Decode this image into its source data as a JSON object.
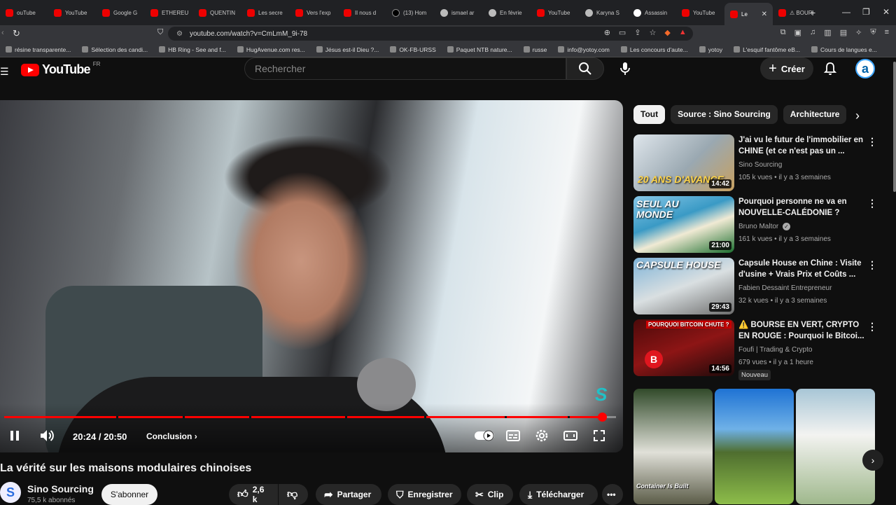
{
  "browser": {
    "tabs": [
      {
        "label": "ouTube",
        "fav": "yt"
      },
      {
        "label": "YouTube",
        "fav": "yt"
      },
      {
        "label": "Google G",
        "fav": "yt"
      },
      {
        "label": "ETHEREU",
        "fav": "yt"
      },
      {
        "label": "QUENTIN",
        "fav": "yt"
      },
      {
        "label": "Les secre",
        "fav": "yt"
      },
      {
        "label": "Vers l'exp",
        "fav": "yt"
      },
      {
        "label": "Il nous d",
        "fav": "yt"
      },
      {
        "label": "(13) Hom",
        "fav": "x"
      },
      {
        "label": "ismael ar",
        "fav": "g"
      },
      {
        "label": "En févrie",
        "fav": "g"
      },
      {
        "label": "YouTube",
        "fav": "yt"
      },
      {
        "label": "Karyna S",
        "fav": "g"
      },
      {
        "label": "Assassin",
        "fav": "w"
      },
      {
        "label": "YouTube",
        "fav": "yt"
      },
      {
        "label": "Le",
        "fav": "yt",
        "active": true
      },
      {
        "label": "⚠ BOUR",
        "fav": "yt"
      }
    ],
    "url": "youtube.com/watch?v=CmLmM_9i-78",
    "bookmarks": [
      "résine transparente...",
      "Sélection des candi...",
      "HB Ring - See and f...",
      "HugAvenue.com res...",
      "Jésus est-il Dieu ?...",
      "OK-FB-URSS",
      "Paquet NTB nature...",
      "russe",
      "info@yotoy.com",
      "Les concours d'aute...",
      "yotoy",
      "L'esquif fantôme eB...",
      "Cours de langues e..."
    ]
  },
  "header": {
    "logo_text": "YouTube",
    "country": "FR",
    "search_placeholder": "Rechercher",
    "create_label": "Créer",
    "avatar_letter": "a"
  },
  "player": {
    "time": "20:24 / 20:50",
    "chapter": "Conclusion",
    "progress": 0.977,
    "watermark": "S"
  },
  "video": {
    "title": "La vérité sur les maisons modulaires chinoises",
    "channel": "Sino Sourcing",
    "subscribers": "75,5 k abonnés",
    "subscribe_label": "S'abonner",
    "likes": "2,6 k",
    "share_label": "Partager",
    "save_label": "Enregistrer",
    "clip_label": "Clip",
    "download_label": "Télécharger"
  },
  "chips": [
    "Tout",
    "Source : Sino Sourcing",
    "Architecture"
  ],
  "recommendations": [
    {
      "title": "J'ai vu le futur de l'immobilier en CHINE (et ce n'est pas un ...",
      "channel": "Sino Sourcing",
      "meta": "105 k vues • il y a 3 semaines",
      "duration": "14:42",
      "thumb_text": "20 ANS D'AVANCE"
    },
    {
      "title": "Pourquoi personne ne va en NOUVELLE-CALÉDONIE ?",
      "channel": "Bruno Maltor",
      "verified": true,
      "meta": "161 k vues • il y a 3 semaines",
      "duration": "21:00",
      "thumb_text": "SEUL AU MONDE"
    },
    {
      "title": "Capsule House en Chine : Visite d'usine + Vrais Prix et Coûts ...",
      "channel": "Fabien Dessaint Entrepreneur",
      "meta": "32 k vues • il y a 3 semaines",
      "duration": "29:43",
      "thumb_text": "CAPSULE HOUSE"
    },
    {
      "title": "⚠️ BOURSE EN VERT, CRYPTO EN ROUGE : Pourquoi le Bitcoi...",
      "channel": "Foufi | Trading & Crypto",
      "meta": "679 vues • il y a 1 heure",
      "duration": "14:56",
      "badge": "Nouveau",
      "thumb_text": "POURQUOI BITCOIN CHUTE ?"
    }
  ],
  "shorts": [
    {
      "caption": "Container Is Built"
    }
  ]
}
